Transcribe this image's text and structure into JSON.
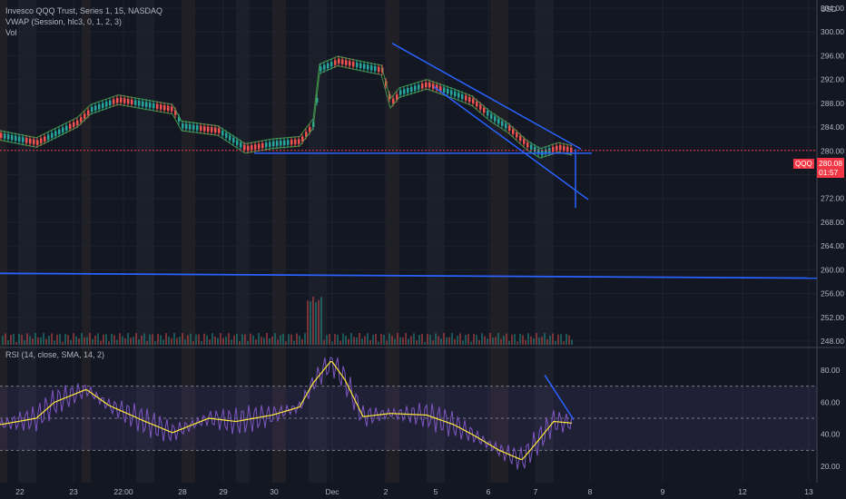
{
  "header": {
    "title": "Invesco QQQ Trust, Series 1, 15, NASDAQ",
    "vwap": "VWAP (Session, hlc3, 0, 1, 2, 3)",
    "vol": "Vol",
    "rsi": "RSI (14, close, SMA, 14, 2)"
  },
  "price_scale": {
    "currency": "USD",
    "ticks": [
      "304.00",
      "300.00",
      "296.00",
      "292.00",
      "288.00",
      "284.00",
      "280.00",
      "276.00",
      "272.00",
      "268.00",
      "264.00",
      "260.00",
      "256.00",
      "252.00",
      "248.00"
    ],
    "tick_values": [
      304,
      300,
      296,
      292,
      288,
      284,
      280,
      276,
      272,
      268,
      264,
      260,
      256,
      252,
      248
    ],
    "current_price": "280.08",
    "current_price_value": 280.08,
    "countdown": "01:57",
    "symbol_tag": "QQQ"
  },
  "rsi_scale": {
    "ticks": [
      "80.00",
      "60.00",
      "40.00",
      "20.00"
    ],
    "tick_values": [
      80,
      60,
      40,
      20
    ],
    "band_upper": 70,
    "band_lower": 30,
    "mid": 50
  },
  "time_axis": {
    "labels": [
      "22",
      "23",
      "22:00",
      "28",
      "29",
      "30",
      "Dec",
      "2",
      "5",
      "6",
      "7",
      "8",
      "9",
      "12",
      "13"
    ]
  },
  "colors": {
    "background": "#131722",
    "candle_up": "#26a69a",
    "candle_down": "#ef5350",
    "trendline": "#2962ff",
    "vwap": "#4caf50",
    "rsi_line": "#7e57c2",
    "rsi_ma": "#ffeb3b",
    "price_line": "#f23645"
  },
  "chart_data": [
    {
      "type": "line",
      "title": "Invesco QQQ Trust, Series 1, 15, NASDAQ",
      "ylabel": "USD",
      "ylim": [
        246,
        306
      ],
      "x": [
        "22",
        "23",
        "22:00",
        "28",
        "29",
        "30",
        "Dec",
        "2",
        "5",
        "6",
        "7",
        "8",
        "9",
        "12",
        "13"
      ],
      "series": [
        {
          "name": "price",
          "values": [
            282.6,
            286.5,
            288.6,
            284.8,
            280.6,
            281.6,
            294.5,
            291.2,
            288.4,
            284.0,
            279.8,
            280.08
          ]
        }
      ],
      "annotations": [
        "descending channel trendlines",
        "support line near 280",
        "long line near 259"
      ]
    },
    {
      "type": "line",
      "title": "RSI (14, close, SMA, 14, 2)",
      "ylim": [
        14,
        90
      ],
      "series": [
        {
          "name": "RSI",
          "values": [
            46,
            52,
            68,
            48,
            41,
            57,
            86,
            51,
            53,
            34,
            24,
            48
          ]
        }
      ]
    }
  ]
}
